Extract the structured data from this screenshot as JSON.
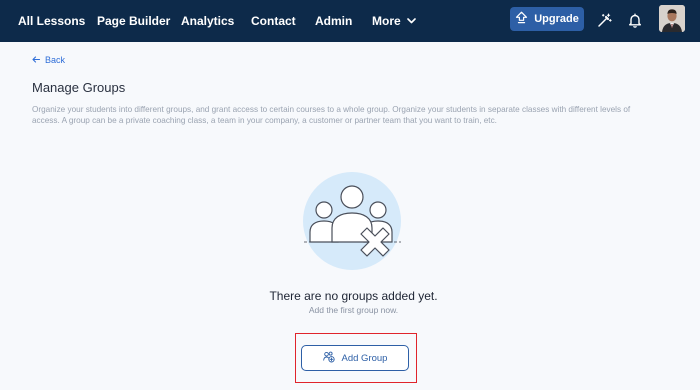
{
  "nav": {
    "items": [
      {
        "label": "All Lessons"
      },
      {
        "label": "Page Builder"
      },
      {
        "label": "Analytics"
      },
      {
        "label": "Contact"
      },
      {
        "label": "Admin"
      },
      {
        "label": "More"
      }
    ],
    "upgrade_label": "Upgrade",
    "icons": [
      "magic-wand-icon",
      "bell-icon",
      "chevron-down-icon",
      "upgrade-arrow-icon"
    ],
    "bg_color": "#0d2a4a",
    "accent_color": "#2d5fa6"
  },
  "page": {
    "back_label": "Back",
    "title": "Manage Groups",
    "description": "Organize your students into different groups, and grant access to certain courses to a whole group. Organize your students in separate classes with different levels of access. A group can be a private coaching class, a team in your company, a customer or partner team that you want to train, etc."
  },
  "empty_state": {
    "title": "There are no groups added yet.",
    "subtitle": "Add the first group now.",
    "illustration_icon": "group-remove-icon",
    "button_label": "Add Group",
    "button_icon": "add-user-group-icon",
    "highlight_color": "#e0242b"
  }
}
